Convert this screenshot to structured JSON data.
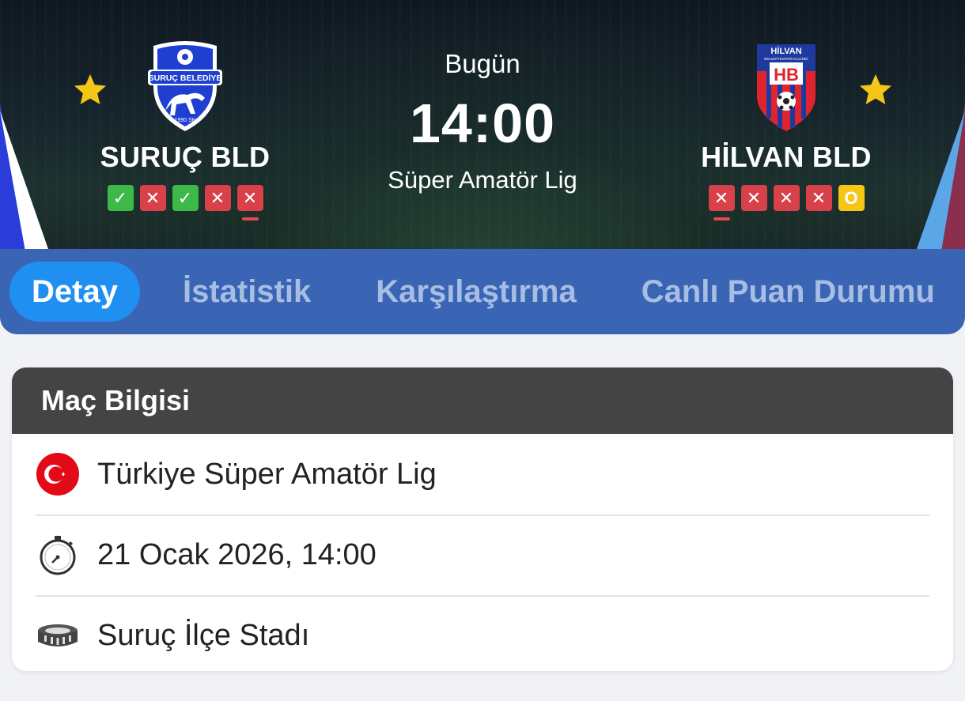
{
  "match": {
    "day": "Bugün",
    "time": "14:00",
    "league": "Süper Amatör Lig"
  },
  "home": {
    "name": "SURUÇ BLD",
    "logo_text": "SURUÇ BELEDİYE",
    "logo_year": "1990 SK",
    "form": [
      "W",
      "L",
      "W",
      "L",
      "L"
    ],
    "colors": [
      "#1e3fd0",
      "#ffffff"
    ]
  },
  "away": {
    "name": "HİLVAN BLD",
    "logo_text": "HİLVAN",
    "logo_subtext": "BELEDİYESPOR KULÜBÜ",
    "logo_initials": "HB",
    "form": [
      "L",
      "L",
      "L",
      "L",
      "D"
    ],
    "colors": [
      "#1e3a9e",
      "#e0242e"
    ]
  },
  "tabs": [
    {
      "label": "Detay",
      "active": true
    },
    {
      "label": "İstatistik",
      "active": false
    },
    {
      "label": "Karşılaştırma",
      "active": false
    },
    {
      "label": "Canlı Puan Durumu",
      "active": false
    }
  ],
  "info": {
    "title": "Maç Bilgisi",
    "rows": [
      {
        "icon": "turkey-flag-icon",
        "text": "Türkiye Süper Amatör Lig"
      },
      {
        "icon": "stopwatch-icon",
        "text": "21 Ocak 2026, 14:00"
      },
      {
        "icon": "stadium-icon",
        "text": "Suruç İlçe Stadı"
      }
    ]
  },
  "colors": {
    "tab_bar": "#3a65b5",
    "tab_active": "#1f8ff2",
    "win": "#3db949",
    "loss": "#d8404a",
    "draw": "#f5c518",
    "star": "#f5c518"
  }
}
